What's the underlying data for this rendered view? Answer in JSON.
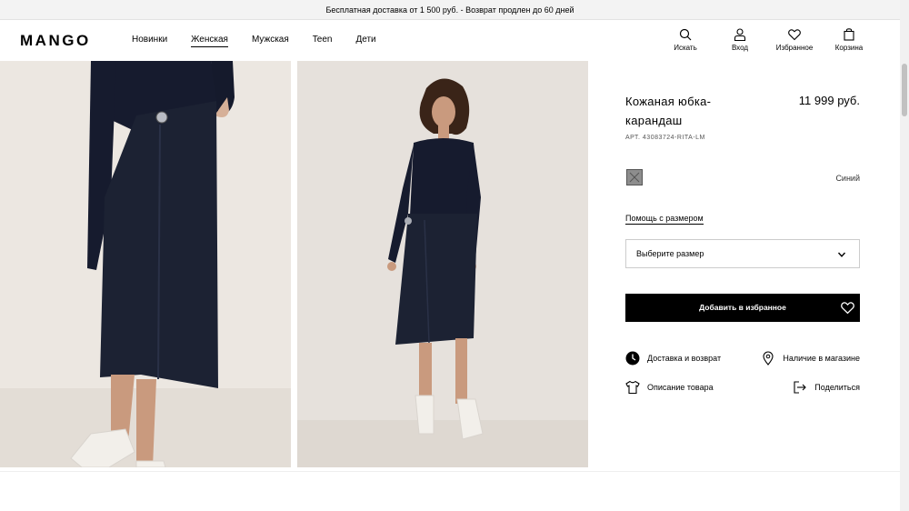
{
  "promo": {
    "text": "Бесплатная доставка от 1 500 руб. - Возврат продлен до 60 дней"
  },
  "header": {
    "logo": "MANGO",
    "nav": [
      "Новинки",
      "Женская",
      "Мужская",
      "Teen",
      "Дети"
    ],
    "active_nav": "Женская",
    "icons": [
      {
        "name": "search-icon",
        "label": "Искать"
      },
      {
        "name": "user-icon",
        "label": "Вход"
      },
      {
        "name": "heart-icon",
        "label": "Избранное"
      },
      {
        "name": "bag-icon",
        "label": "Корзина"
      }
    ]
  },
  "product": {
    "title": "Кожаная юбка-карандаш",
    "price": "11 999 руб.",
    "article": "АРТ. 43083724-RITA-LM",
    "color_name": "Синий",
    "size_help": "Помощь с размером",
    "size_placeholder": "Выберите размер",
    "add_to_favorites": "Добавить в избранное"
  },
  "links": {
    "delivery": "Доставка и возврат",
    "store": "Наличие в магазине",
    "description": "Описание товара",
    "share": "Поделиться"
  },
  "colors": {
    "accent": "#000000",
    "promo_bg": "#f3f3f3",
    "skirt": "#1c2233",
    "top": "#161b2e"
  }
}
